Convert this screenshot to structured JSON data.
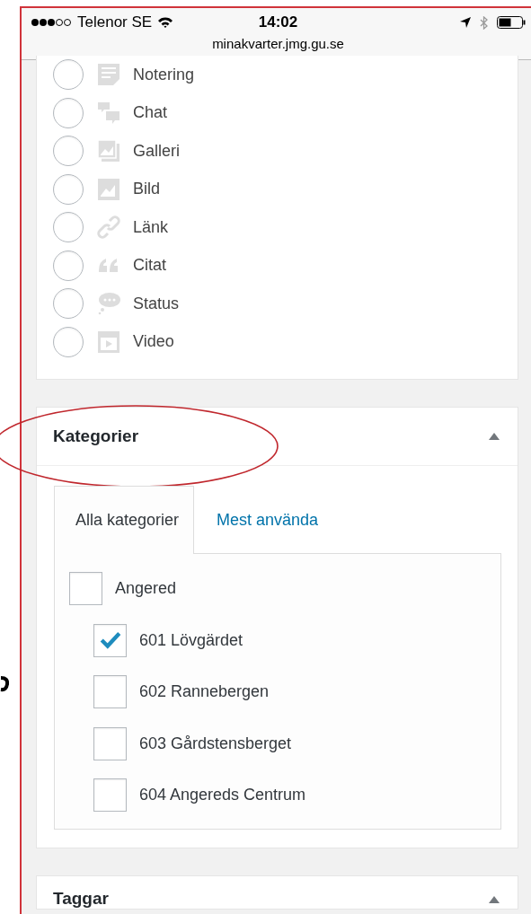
{
  "status_bar": {
    "carrier": "Telenor SE",
    "time": "14:02",
    "url": "minakvarter.jmg.gu.se"
  },
  "post_formats": [
    {
      "label": "Notering",
      "kind": "note",
      "selected": false
    },
    {
      "label": "Chat",
      "kind": "chat",
      "selected": false
    },
    {
      "label": "Galleri",
      "kind": "gallery",
      "selected": false
    },
    {
      "label": "Bild",
      "kind": "image",
      "selected": false
    },
    {
      "label": "Länk",
      "kind": "link",
      "selected": false
    },
    {
      "label": "Citat",
      "kind": "quote",
      "selected": false
    },
    {
      "label": "Status",
      "kind": "status",
      "selected": false
    },
    {
      "label": "Video",
      "kind": "video",
      "selected": false
    }
  ],
  "categories_box": {
    "title": "Kategorier",
    "expanded": true,
    "tabs": [
      {
        "label": "Alla kategorier",
        "selected": true
      },
      {
        "label": "Mest använda",
        "selected": false
      }
    ],
    "categories": [
      {
        "label": "Angered",
        "checked": false,
        "children": [
          {
            "label": "601 Lövgärdet",
            "checked": true
          },
          {
            "label": "602 Rannebergen",
            "checked": false
          },
          {
            "label": "603 Gårdstensberget",
            "checked": false
          },
          {
            "label": "604 Angereds Centrum",
            "checked": false
          }
        ]
      }
    ]
  },
  "tags_box": {
    "title": "Taggar",
    "expanded": true
  }
}
